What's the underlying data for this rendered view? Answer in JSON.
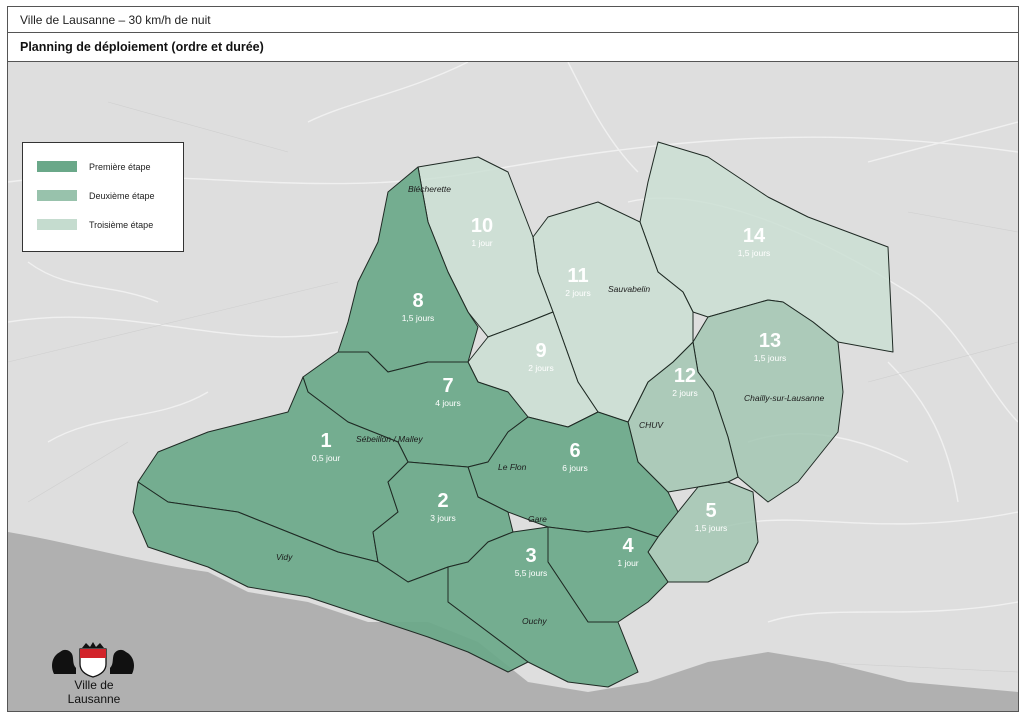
{
  "header": {
    "title": "Ville de Lausanne – 30 km/h de nuit",
    "subtitle": "Planning de déploiement (ordre et durée)"
  },
  "legend": {
    "items": [
      {
        "label": "Première étape",
        "color": "#6aa889"
      },
      {
        "label": "Deuxième étape",
        "color": "#98c2ac"
      },
      {
        "label": "Troisième étape",
        "color": "#c5dccf"
      }
    ]
  },
  "colors": {
    "stage1": "#6aa889",
    "stage2": "#a3c7b3",
    "stage3": "#c9ded2",
    "border": "#1f2a24",
    "lake": "#a8a8a8",
    "land": "#dcdcdc"
  },
  "sectors": [
    {
      "number": "1",
      "duration": "0,5 jour",
      "stage": 1
    },
    {
      "number": "2",
      "duration": "3 jours",
      "stage": 1
    },
    {
      "number": "3",
      "duration": "5,5 jours",
      "stage": 1
    },
    {
      "number": "4",
      "duration": "1 jour",
      "stage": 1
    },
    {
      "number": "5",
      "duration": "1,5 jours",
      "stage": 2
    },
    {
      "number": "6",
      "duration": "6 jours",
      "stage": 1
    },
    {
      "number": "7",
      "duration": "4 jours",
      "stage": 1
    },
    {
      "number": "8",
      "duration": "1,5 jours",
      "stage": 1
    },
    {
      "number": "9",
      "duration": "2 jours",
      "stage": 3
    },
    {
      "number": "10",
      "duration": "1 jour",
      "stage": 3
    },
    {
      "number": "11",
      "duration": "2 jours",
      "stage": 3
    },
    {
      "number": "12",
      "duration": "2 jours",
      "stage": 2
    },
    {
      "number": "13",
      "duration": "1,5 jours",
      "stage": 2
    },
    {
      "number": "14",
      "duration": "1,5 jours",
      "stage": 3
    }
  ],
  "places": [
    "Blécherette",
    "Sauvabelin",
    "Sébeillon / Malley",
    "Le Flon",
    "Gare",
    "Vidy",
    "Ouchy",
    "CHUV",
    "Chailly-sur-Lausanne"
  ],
  "logo": {
    "text": "Ville de Lausanne",
    "icon": "lausanne-coat-of-arms-icon"
  }
}
